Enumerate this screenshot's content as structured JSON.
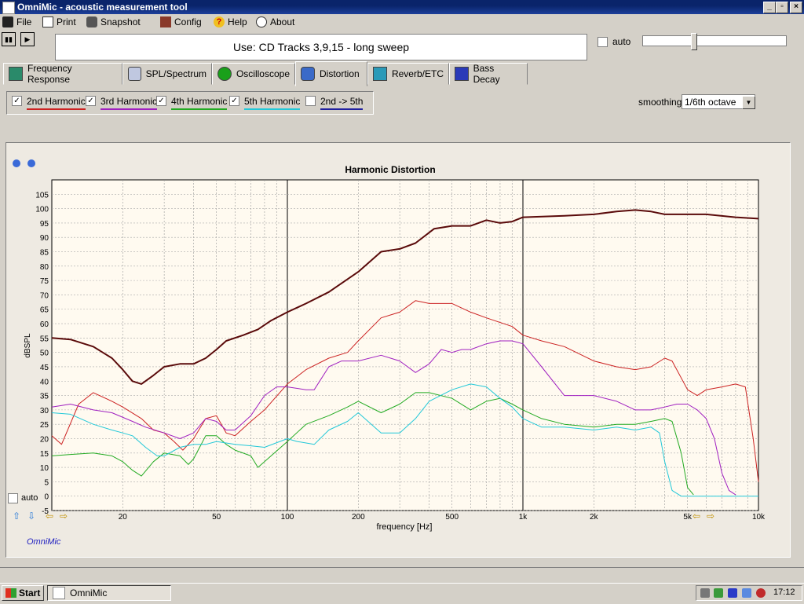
{
  "window": {
    "title": "OmniMic - acoustic measurement tool",
    "minimize": "_",
    "maximize": "▫",
    "close": "×"
  },
  "menu": {
    "items": [
      {
        "label": "File",
        "icon": "save-icon"
      },
      {
        "label": "Print",
        "icon": "printer-icon"
      },
      {
        "label": "Snapshot",
        "icon": "camera-icon"
      },
      {
        "label": "Config",
        "icon": "tools-icon"
      },
      {
        "label": "Help",
        "icon": "question-icon"
      },
      {
        "label": "About",
        "icon": "speech-bubble-icon"
      }
    ]
  },
  "toolbar": {
    "pause_glyph": "▮▮",
    "play_glyph": "▶",
    "use_text": "Use: CD Tracks 3,9,15 - long sweep",
    "auto_label": "auto",
    "level_slider": 0.34
  },
  "tabs": [
    {
      "label": "Frequency Response",
      "icon": "frequency-response-icon"
    },
    {
      "label": "SPL/Spectrum",
      "icon": "spl-icon"
    },
    {
      "label": "Oscilloscope",
      "icon": "oscilloscope-icon"
    },
    {
      "label": "Distortion",
      "icon": "distortion-icon",
      "active": true
    },
    {
      "label": "Reverb/ETC",
      "icon": "reverb-icon"
    },
    {
      "label": "Bass Decay",
      "icon": "bass-decay-icon"
    }
  ],
  "harmonics": [
    {
      "label": "2nd Harmonic",
      "checked": true,
      "color": "#cc2222"
    },
    {
      "label": "3rd Harmonic",
      "checked": true,
      "color": "#a020c0"
    },
    {
      "label": "4th Harmonic",
      "checked": true,
      "color": "#22aa22"
    },
    {
      "label": "5th Harmonic",
      "checked": true,
      "color": "#22c8d8"
    },
    {
      "label": "2nd -> 5th",
      "checked": false,
      "color": "#2020a0"
    }
  ],
  "smoothing": {
    "label": "smoothing",
    "value": "1/6th octave"
  },
  "chart_auto_label": "auto",
  "brand": "OmniMic",
  "taskbar": {
    "start": "Start",
    "app": "OmniMic",
    "clock": "17:12"
  },
  "chart_data": {
    "type": "line",
    "title": "Harmonic Distortion",
    "xlabel": "frequency [Hz]",
    "ylabel": "dBSPL",
    "xscale": "log",
    "xlim": [
      10,
      10000
    ],
    "ylim": [
      -5,
      105
    ],
    "x_ticks": [
      20,
      50,
      100,
      200,
      500,
      "1k",
      "2k",
      "5k",
      "10k"
    ],
    "y_ticks": [
      105,
      100,
      95,
      90,
      85,
      80,
      75,
      70,
      65,
      60,
      55,
      50,
      45,
      40,
      35,
      30,
      25,
      20,
      15,
      10,
      5,
      0,
      -5
    ],
    "grid": true,
    "series": [
      {
        "name": "fundamental",
        "color": "#5a0a0a",
        "width": 2,
        "points": [
          [
            10,
            55
          ],
          [
            12,
            54.5
          ],
          [
            15,
            52
          ],
          [
            18,
            48
          ],
          [
            20,
            44
          ],
          [
            22,
            40
          ],
          [
            24,
            39
          ],
          [
            27,
            42
          ],
          [
            30,
            45
          ],
          [
            35,
            46
          ],
          [
            40,
            46
          ],
          [
            45,
            48
          ],
          [
            50,
            51
          ],
          [
            55,
            54
          ],
          [
            65,
            56
          ],
          [
            75,
            58
          ],
          [
            85,
            61
          ],
          [
            100,
            64
          ],
          [
            120,
            67
          ],
          [
            150,
            71
          ],
          [
            200,
            78
          ],
          [
            250,
            85
          ],
          [
            300,
            86
          ],
          [
            350,
            88
          ],
          [
            420,
            93
          ],
          [
            500,
            94
          ],
          [
            600,
            94
          ],
          [
            700,
            96
          ],
          [
            800,
            95
          ],
          [
            900,
            95.5
          ],
          [
            1000,
            97
          ],
          [
            1500,
            97.5
          ],
          [
            2000,
            98
          ],
          [
            2500,
            99
          ],
          [
            3000,
            99.5
          ],
          [
            3500,
            99
          ],
          [
            4000,
            98
          ],
          [
            5000,
            98
          ],
          [
            6000,
            98
          ],
          [
            8000,
            97
          ],
          [
            10000,
            96.5
          ]
        ]
      },
      {
        "name": "2nd Harmonic",
        "color": "#cc2222",
        "width": 1,
        "points": [
          [
            10,
            21
          ],
          [
            11,
            18
          ],
          [
            13,
            32
          ],
          [
            15,
            36
          ],
          [
            18,
            33
          ],
          [
            20,
            31
          ],
          [
            24,
            27
          ],
          [
            27,
            23
          ],
          [
            30,
            22
          ],
          [
            33,
            19
          ],
          [
            36,
            16
          ],
          [
            40,
            20
          ],
          [
            45,
            27
          ],
          [
            50,
            28
          ],
          [
            55,
            22
          ],
          [
            60,
            21
          ],
          [
            70,
            26
          ],
          [
            80,
            30
          ],
          [
            100,
            39
          ],
          [
            120,
            44
          ],
          [
            150,
            48
          ],
          [
            180,
            50
          ],
          [
            200,
            54
          ],
          [
            250,
            62
          ],
          [
            300,
            64
          ],
          [
            350,
            68
          ],
          [
            400,
            67
          ],
          [
            500,
            67
          ],
          [
            600,
            64
          ],
          [
            700,
            62
          ],
          [
            900,
            59
          ],
          [
            1000,
            56
          ],
          [
            1200,
            54
          ],
          [
            1500,
            52
          ],
          [
            2000,
            47
          ],
          [
            2500,
            45
          ],
          [
            3000,
            44
          ],
          [
            3500,
            45
          ],
          [
            4000,
            48
          ],
          [
            4300,
            47
          ],
          [
            5000,
            37
          ],
          [
            5500,
            35
          ],
          [
            6000,
            37
          ],
          [
            7000,
            38
          ],
          [
            8000,
            39
          ],
          [
            8800,
            38
          ],
          [
            9500,
            20
          ],
          [
            10000,
            5
          ]
        ]
      },
      {
        "name": "3rd Harmonic",
        "color": "#a020c0",
        "width": 1,
        "points": [
          [
            10,
            31
          ],
          [
            12,
            32
          ],
          [
            15,
            30
          ],
          [
            18,
            29
          ],
          [
            22,
            26
          ],
          [
            25,
            24
          ],
          [
            30,
            22
          ],
          [
            35,
            20
          ],
          [
            40,
            22
          ],
          [
            45,
            27
          ],
          [
            50,
            26
          ],
          [
            55,
            23
          ],
          [
            60,
            23
          ],
          [
            70,
            28
          ],
          [
            80,
            35
          ],
          [
            90,
            38
          ],
          [
            100,
            38
          ],
          [
            120,
            37
          ],
          [
            130,
            37
          ],
          [
            150,
            45
          ],
          [
            170,
            47
          ],
          [
            200,
            47
          ],
          [
            250,
            49
          ],
          [
            300,
            47
          ],
          [
            350,
            43
          ],
          [
            400,
            46
          ],
          [
            450,
            51
          ],
          [
            500,
            50
          ],
          [
            550,
            51
          ],
          [
            600,
            51
          ],
          [
            700,
            53
          ],
          [
            800,
            54
          ],
          [
            900,
            54
          ],
          [
            1000,
            53
          ],
          [
            1200,
            45
          ],
          [
            1500,
            35
          ],
          [
            2000,
            35
          ],
          [
            2500,
            33
          ],
          [
            3000,
            30
          ],
          [
            3500,
            30
          ],
          [
            4000,
            31
          ],
          [
            4500,
            32
          ],
          [
            5000,
            32
          ],
          [
            5500,
            30
          ],
          [
            6000,
            27
          ],
          [
            6500,
            20
          ],
          [
            7000,
            8
          ],
          [
            7500,
            2
          ],
          [
            8000,
            0.5
          ]
        ]
      },
      {
        "name": "4th Harmonic",
        "color": "#22aa22",
        "width": 1,
        "points": [
          [
            10,
            14
          ],
          [
            12,
            14.5
          ],
          [
            15,
            15
          ],
          [
            18,
            14
          ],
          [
            20,
            12
          ],
          [
            22,
            9
          ],
          [
            24,
            7
          ],
          [
            27,
            12
          ],
          [
            30,
            15
          ],
          [
            35,
            14
          ],
          [
            38,
            11
          ],
          [
            40,
            13
          ],
          [
            45,
            21
          ],
          [
            50,
            21
          ],
          [
            55,
            18
          ],
          [
            60,
            16
          ],
          [
            70,
            14
          ],
          [
            75,
            10
          ],
          [
            80,
            12
          ],
          [
            100,
            19
          ],
          [
            120,
            25
          ],
          [
            150,
            28
          ],
          [
            180,
            31
          ],
          [
            200,
            33
          ],
          [
            250,
            29
          ],
          [
            300,
            32
          ],
          [
            350,
            36
          ],
          [
            400,
            36
          ],
          [
            500,
            34
          ],
          [
            600,
            30
          ],
          [
            700,
            33
          ],
          [
            800,
            34
          ],
          [
            900,
            32
          ],
          [
            1000,
            30
          ],
          [
            1200,
            27
          ],
          [
            1500,
            25
          ],
          [
            2000,
            24
          ],
          [
            2500,
            25
          ],
          [
            3000,
            25
          ],
          [
            3500,
            26
          ],
          [
            4000,
            27
          ],
          [
            4300,
            26
          ],
          [
            4700,
            15
          ],
          [
            5000,
            3
          ],
          [
            5300,
            0.5
          ]
        ]
      },
      {
        "name": "5th Harmonic",
        "color": "#22c8d8",
        "width": 1,
        "points": [
          [
            10,
            29
          ],
          [
            12,
            28.5
          ],
          [
            15,
            25
          ],
          [
            18,
            23
          ],
          [
            20,
            22
          ],
          [
            22,
            21
          ],
          [
            25,
            17
          ],
          [
            28,
            14
          ],
          [
            30,
            14
          ],
          [
            35,
            17
          ],
          [
            40,
            18
          ],
          [
            45,
            18
          ],
          [
            50,
            19
          ],
          [
            60,
            18
          ],
          [
            70,
            17.5
          ],
          [
            80,
            17
          ],
          [
            100,
            20
          ],
          [
            110,
            19
          ],
          [
            130,
            18
          ],
          [
            150,
            23
          ],
          [
            180,
            26
          ],
          [
            200,
            29
          ],
          [
            250,
            22
          ],
          [
            300,
            22
          ],
          [
            350,
            27
          ],
          [
            400,
            33
          ],
          [
            500,
            37
          ],
          [
            600,
            39
          ],
          [
            700,
            38
          ],
          [
            800,
            34
          ],
          [
            900,
            31
          ],
          [
            1000,
            27
          ],
          [
            1200,
            24
          ],
          [
            1500,
            24
          ],
          [
            2000,
            23
          ],
          [
            2500,
            24
          ],
          [
            3000,
            23
          ],
          [
            3500,
            24
          ],
          [
            3800,
            22
          ],
          [
            4000,
            12
          ],
          [
            4300,
            2
          ],
          [
            4700,
            0
          ]
        ]
      }
    ],
    "tail": {
      "color": "#22c8d8",
      "points": [
        [
          4700,
          0
        ],
        [
          10000,
          0
        ]
      ]
    }
  }
}
